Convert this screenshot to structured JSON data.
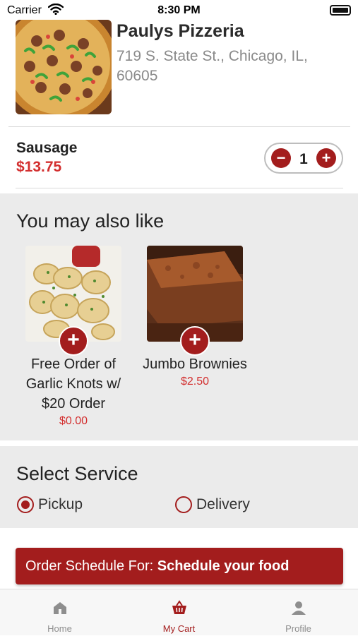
{
  "status_bar": {
    "carrier": "Carrier",
    "time": "8:30 PM"
  },
  "restaurant": {
    "name": "Paulys Pizzeria",
    "address": "719 S. State St., Chicago, IL, 60605",
    "image_icon": "pizza-image"
  },
  "cart_item": {
    "name": "Sausage",
    "price": "$13.75",
    "quantity": "1",
    "minus": "−",
    "plus": "+"
  },
  "suggestions": {
    "title": "You may also like",
    "items": [
      {
        "name": "Free Order of Garlic Knots w/ $20 Order",
        "price": "$0.00",
        "add": "+"
      },
      {
        "name": "Jumbo Brownies",
        "price": "$2.50",
        "add": "+"
      }
    ]
  },
  "service": {
    "title": "Select Service",
    "options": [
      {
        "label": "Pickup",
        "selected": true
      },
      {
        "label": "Delivery",
        "selected": false
      }
    ]
  },
  "schedule": {
    "prefix": "Order Schedule For: ",
    "value": "Schedule your food"
  },
  "tabs": [
    {
      "label": "Home",
      "icon": "home-icon",
      "active": false
    },
    {
      "label": "My Cart",
      "icon": "basket-icon",
      "active": true
    },
    {
      "label": "Profile",
      "icon": "person-icon",
      "active": false
    }
  ],
  "colors": {
    "accent": "#a31d1d",
    "price": "#d32f2f",
    "section_bg": "#ebebeb"
  }
}
